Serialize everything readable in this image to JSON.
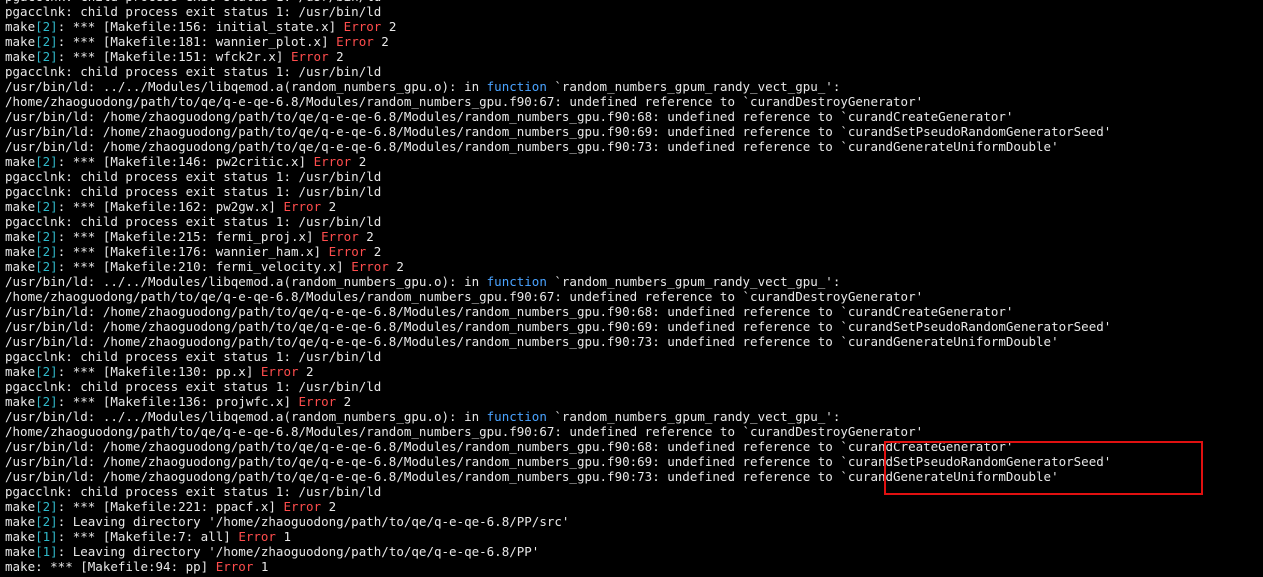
{
  "colors": {
    "background": "#000000",
    "text": "#e8e8e8",
    "error": "#ff4d4d",
    "keyword": "#4aa3ff",
    "bracket_num": "#2fb7c7",
    "highlight_box": "#e01010"
  },
  "lines": [
    [
      {
        "t": "pgacclnk: child process exit status 1: /usr/bin/ld"
      }
    ],
    [
      {
        "t": "pgacclnk: child process exit status 1: /usr/bin/ld"
      }
    ],
    [
      {
        "t": "make"
      },
      {
        "t": "[2]",
        "c": "cyan"
      },
      {
        "t": ": *** [Makefile:156: initial_state.x] "
      },
      {
        "t": "Error",
        "c": "err"
      },
      {
        "t": " 2"
      }
    ],
    [
      {
        "t": "make"
      },
      {
        "t": "[2]",
        "c": "cyan"
      },
      {
        "t": ": *** [Makefile:181: wannier_plot.x] "
      },
      {
        "t": "Error",
        "c": "err"
      },
      {
        "t": " 2"
      }
    ],
    [
      {
        "t": "make"
      },
      {
        "t": "[2]",
        "c": "cyan"
      },
      {
        "t": ": *** [Makefile:151: wfck2r.x] "
      },
      {
        "t": "Error",
        "c": "err"
      },
      {
        "t": " 2"
      }
    ],
    [
      {
        "t": "pgacclnk: child process exit status 1: /usr/bin/ld"
      }
    ],
    [
      {
        "t": "/usr/bin/ld: ../../Modules/libqemod.a(random_numbers_gpu.o): in "
      },
      {
        "t": "function",
        "c": "blue"
      },
      {
        "t": " `random_numbers_gpum_randy_vect_gpu_':"
      }
    ],
    [
      {
        "t": "/home/zhaoguodong/path/to/qe/q-e-qe-6.8/Modules/random_numbers_gpu.f90:67: undefined reference to `curandDestroyGenerator'"
      }
    ],
    [
      {
        "t": "/usr/bin/ld: /home/zhaoguodong/path/to/qe/q-e-qe-6.8/Modules/random_numbers_gpu.f90:68: undefined reference to `curandCreateGenerator'"
      }
    ],
    [
      {
        "t": "/usr/bin/ld: /home/zhaoguodong/path/to/qe/q-e-qe-6.8/Modules/random_numbers_gpu.f90:69: undefined reference to `curandSetPseudoRandomGeneratorSeed'"
      }
    ],
    [
      {
        "t": "/usr/bin/ld: /home/zhaoguodong/path/to/qe/q-e-qe-6.8/Modules/random_numbers_gpu.f90:73: undefined reference to `curandGenerateUniformDouble'"
      }
    ],
    [
      {
        "t": "make"
      },
      {
        "t": "[2]",
        "c": "cyan"
      },
      {
        "t": ": *** [Makefile:146: pw2critic.x] "
      },
      {
        "t": "Error",
        "c": "err"
      },
      {
        "t": " 2"
      }
    ],
    [
      {
        "t": "pgacclnk: child process exit status 1: /usr/bin/ld"
      }
    ],
    [
      {
        "t": "pgacclnk: child process exit status 1: /usr/bin/ld"
      }
    ],
    [
      {
        "t": "make"
      },
      {
        "t": "[2]",
        "c": "cyan"
      },
      {
        "t": ": *** [Makefile:162: pw2gw.x] "
      },
      {
        "t": "Error",
        "c": "err"
      },
      {
        "t": " 2"
      }
    ],
    [
      {
        "t": "pgacclnk: child process exit status 1: /usr/bin/ld"
      }
    ],
    [
      {
        "t": "make"
      },
      {
        "t": "[2]",
        "c": "cyan"
      },
      {
        "t": ": *** [Makefile:215: fermi_proj.x] "
      },
      {
        "t": "Error",
        "c": "err"
      },
      {
        "t": " 2"
      }
    ],
    [
      {
        "t": "make"
      },
      {
        "t": "[2]",
        "c": "cyan"
      },
      {
        "t": ": *** [Makefile:176: wannier_ham.x] "
      },
      {
        "t": "Error",
        "c": "err"
      },
      {
        "t": " 2"
      }
    ],
    [
      {
        "t": "make"
      },
      {
        "t": "[2]",
        "c": "cyan"
      },
      {
        "t": ": *** [Makefile:210: fermi_velocity.x] "
      },
      {
        "t": "Error",
        "c": "err"
      },
      {
        "t": " 2"
      }
    ],
    [
      {
        "t": "/usr/bin/ld: ../../Modules/libqemod.a(random_numbers_gpu.o): in "
      },
      {
        "t": "function",
        "c": "blue"
      },
      {
        "t": " `random_numbers_gpum_randy_vect_gpu_':"
      }
    ],
    [
      {
        "t": "/home/zhaoguodong/path/to/qe/q-e-qe-6.8/Modules/random_numbers_gpu.f90:67: undefined reference to `curandDestroyGenerator'"
      }
    ],
    [
      {
        "t": "/usr/bin/ld: /home/zhaoguodong/path/to/qe/q-e-qe-6.8/Modules/random_numbers_gpu.f90:68: undefined reference to `curandCreateGenerator'"
      }
    ],
    [
      {
        "t": "/usr/bin/ld: /home/zhaoguodong/path/to/qe/q-e-qe-6.8/Modules/random_numbers_gpu.f90:69: undefined reference to `curandSetPseudoRandomGeneratorSeed'"
      }
    ],
    [
      {
        "t": "/usr/bin/ld: /home/zhaoguodong/path/to/qe/q-e-qe-6.8/Modules/random_numbers_gpu.f90:73: undefined reference to `curandGenerateUniformDouble'"
      }
    ],
    [
      {
        "t": "pgacclnk: child process exit status 1: /usr/bin/ld"
      }
    ],
    [
      {
        "t": "make"
      },
      {
        "t": "[2]",
        "c": "cyan"
      },
      {
        "t": ": *** [Makefile:130: pp.x] "
      },
      {
        "t": "Error",
        "c": "err"
      },
      {
        "t": " 2"
      }
    ],
    [
      {
        "t": "pgacclnk: child process exit status 1: /usr/bin/ld"
      }
    ],
    [
      {
        "t": "make"
      },
      {
        "t": "[2]",
        "c": "cyan"
      },
      {
        "t": ": *** [Makefile:136: projwfc.x] "
      },
      {
        "t": "Error",
        "c": "err"
      },
      {
        "t": " 2"
      }
    ],
    [
      {
        "t": "/usr/bin/ld: ../../Modules/libqemod.a(random_numbers_gpu.o): in "
      },
      {
        "t": "function",
        "c": "blue"
      },
      {
        "t": " `random_numbers_gpum_randy_vect_gpu_':"
      }
    ],
    [
      {
        "t": "/home/zhaoguodong/path/to/qe/q-e-qe-6.8/Modules/random_numbers_gpu.f90:67: undefined reference to `curandDestroyGenerator'"
      }
    ],
    [
      {
        "t": "/usr/bin/ld: /home/zhaoguodong/path/to/qe/q-e-qe-6.8/Modules/random_numbers_gpu.f90:68: undefined reference to `curandCreateGenerator'"
      }
    ],
    [
      {
        "t": "/usr/bin/ld: /home/zhaoguodong/path/to/qe/q-e-qe-6.8/Modules/random_numbers_gpu.f90:69: undefined reference to `curandSetPseudoRandomGeneratorSeed'"
      }
    ],
    [
      {
        "t": "/usr/bin/ld: /home/zhaoguodong/path/to/qe/q-e-qe-6.8/Modules/random_numbers_gpu.f90:73: undefined reference to `curandGenerateUniformDouble'"
      }
    ],
    [
      {
        "t": "pgacclnk: child process exit status 1: /usr/bin/ld"
      }
    ],
    [
      {
        "t": "make"
      },
      {
        "t": "[2]",
        "c": "cyan"
      },
      {
        "t": ": *** [Makefile:221: ppacf.x] "
      },
      {
        "t": "Error",
        "c": "err"
      },
      {
        "t": " 2"
      }
    ],
    [
      {
        "t": "make"
      },
      {
        "t": "[2]",
        "c": "cyan"
      },
      {
        "t": ": Leaving directory '/home/zhaoguodong/path/to/qe/q-e-qe-6.8/PP/src'"
      }
    ],
    [
      {
        "t": "make"
      },
      {
        "t": "[1]",
        "c": "cyan"
      },
      {
        "t": ": *** [Makefile:7: all] "
      },
      {
        "t": "Error",
        "c": "err"
      },
      {
        "t": " 1"
      }
    ],
    [
      {
        "t": "make"
      },
      {
        "t": "[1]",
        "c": "cyan"
      },
      {
        "t": ": Leaving directory '/home/zhaoguodong/path/to/qe/q-e-qe-6.8/PP'"
      }
    ],
    [
      {
        "t": "make: *** [Makefile:94: pp] "
      },
      {
        "t": "Error",
        "c": "err"
      },
      {
        "t": " 1"
      }
    ]
  ]
}
